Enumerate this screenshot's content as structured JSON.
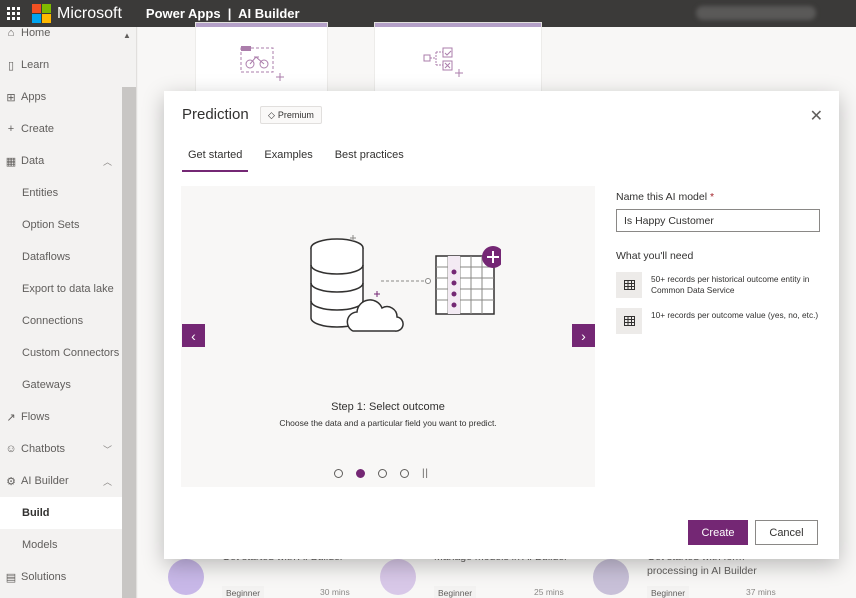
{
  "topbar": {
    "brand": "Microsoft",
    "app_title": "Power Apps  |  AI Builder",
    "colors": {
      "bar": "#3b3a39",
      "logo": [
        "#f25022",
        "#7fba00",
        "#00a4ef",
        "#ffb900"
      ]
    }
  },
  "sidebar": {
    "items": [
      {
        "label": "Home",
        "icon": "home-icon"
      },
      {
        "label": "Learn",
        "icon": "book-icon"
      },
      {
        "label": "Apps",
        "icon": "apps-icon"
      },
      {
        "label": "Create",
        "icon": "plus-icon"
      },
      {
        "label": "Data",
        "icon": "table-icon",
        "expanded": true
      },
      {
        "label": "Entities"
      },
      {
        "label": "Option Sets"
      },
      {
        "label": "Dataflows"
      },
      {
        "label": "Export to data lake"
      },
      {
        "label": "Connections"
      },
      {
        "label": "Custom Connectors"
      },
      {
        "label": "Gateways"
      },
      {
        "label": "Flows",
        "icon": "flow-icon"
      },
      {
        "label": "Chatbots",
        "icon": "chatbot-icon",
        "expanded": false
      },
      {
        "label": "AI Builder",
        "icon": "ai-builder-icon",
        "expanded": true
      },
      {
        "label": "Build",
        "active": true
      },
      {
        "label": "Models"
      },
      {
        "label": "Solutions",
        "icon": "solutions-icon"
      }
    ]
  },
  "modal": {
    "title": "Prediction",
    "badge": "Premium",
    "tabs": [
      {
        "label": "Get started",
        "active": true
      },
      {
        "label": "Examples"
      },
      {
        "label": "Best practices"
      }
    ],
    "carousel": {
      "step_title": "Step 1: Select outcome",
      "step_desc": "Choose the data and a particular field you want to predict.",
      "current_slide": 2,
      "total_slides": 4
    },
    "name_label": "Name this AI model",
    "name_required_mark": "*",
    "name_value": "Is Happy Customer",
    "need_title": "What you'll need",
    "requirements": [
      "50+ records per historical outcome entity in Common Data Service",
      "10+ records per outcome value (yes, no, etc.)"
    ],
    "create_label": "Create",
    "cancel_label": "Cancel",
    "accent": "#742774"
  },
  "bottom_cards": [
    {
      "title": "Get started with AI Builder",
      "tag": "Beginner",
      "mins": "30 mins"
    },
    {
      "title": "Manage models in AI Builder",
      "tag": "Beginner",
      "mins": "25 mins"
    },
    {
      "title": "Get started with form processing in AI Builder",
      "tag": "Beginner",
      "mins": "37 mins"
    }
  ]
}
